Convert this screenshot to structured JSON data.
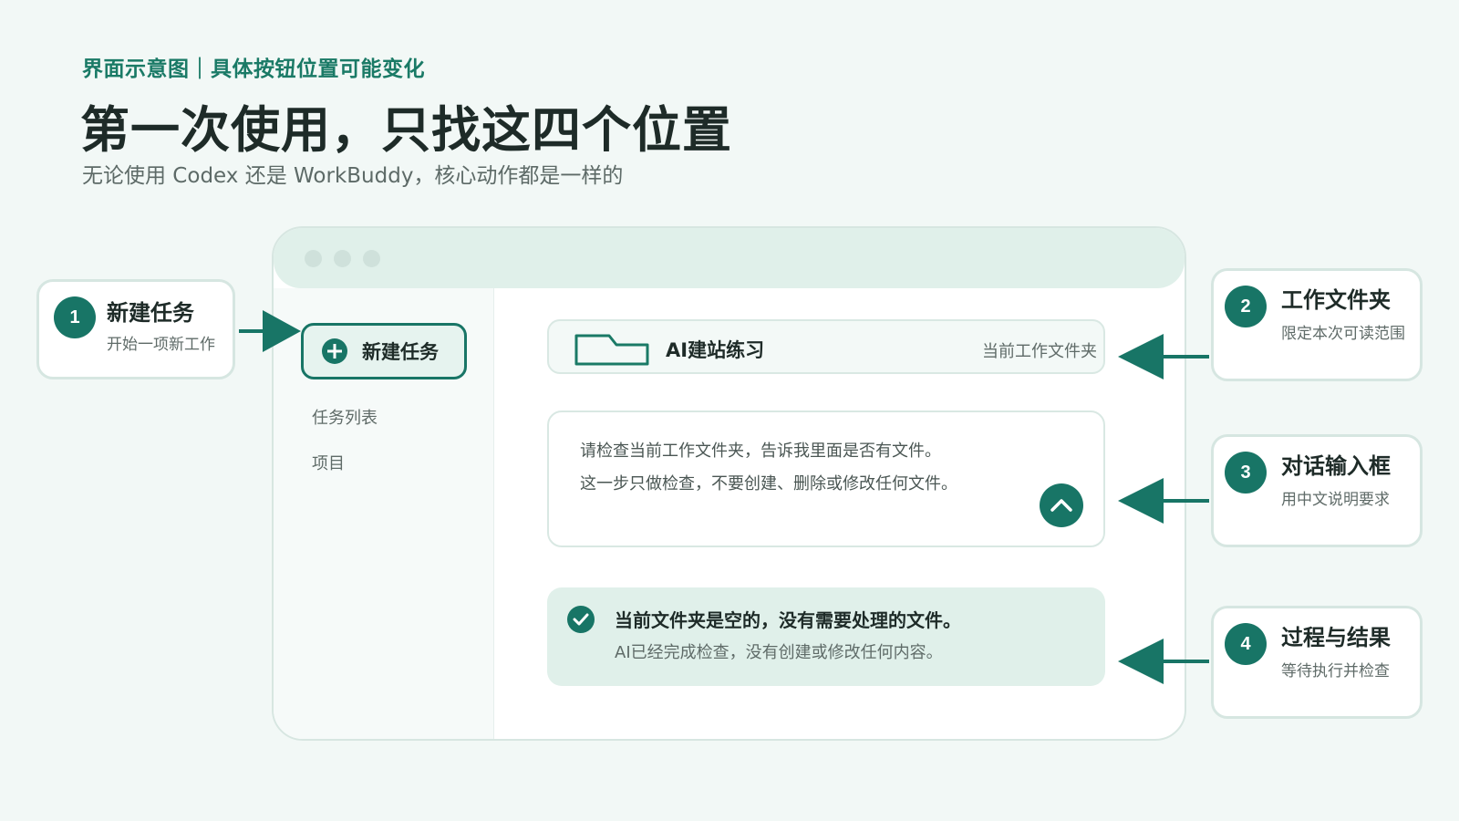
{
  "header": {
    "eyebrow": "界面示意图｜具体按钮位置可能变化",
    "title": "第一次使用，只找这四个位置",
    "subtitle": "无论使用 Codex 还是 WorkBuddy，核心动作都是一样的"
  },
  "window": {
    "sidebar": {
      "new_task_label": "新建任务",
      "items": [
        {
          "label": "任务列表"
        },
        {
          "label": "项目"
        }
      ]
    },
    "folder": {
      "name": "AI建站练习",
      "hint": "当前工作文件夹"
    },
    "chat": {
      "lines": [
        "请检查当前工作文件夹，告诉我里面是否有文件。",
        "这一步只做检查，不要创建、删除或修改任何文件。"
      ]
    },
    "result": {
      "title": "当前文件夹是空的，没有需要处理的文件。",
      "detail": "AI已经完成检查，没有创建或修改任何内容。"
    }
  },
  "callouts": [
    {
      "number": "1",
      "title": "新建任务",
      "desc": "开始一项新工作"
    },
    {
      "number": "2",
      "title": "工作文件夹",
      "desc": "限定本次可读范围"
    },
    {
      "number": "3",
      "title": "对话输入框",
      "desc": "用中文说明要求"
    },
    {
      "number": "4",
      "title": "过程与结果",
      "desc": "等待执行并检查"
    }
  ],
  "colors": {
    "accent": "#187566",
    "background": "#f2f8f6",
    "panel_tint": "#e0f0ea"
  }
}
